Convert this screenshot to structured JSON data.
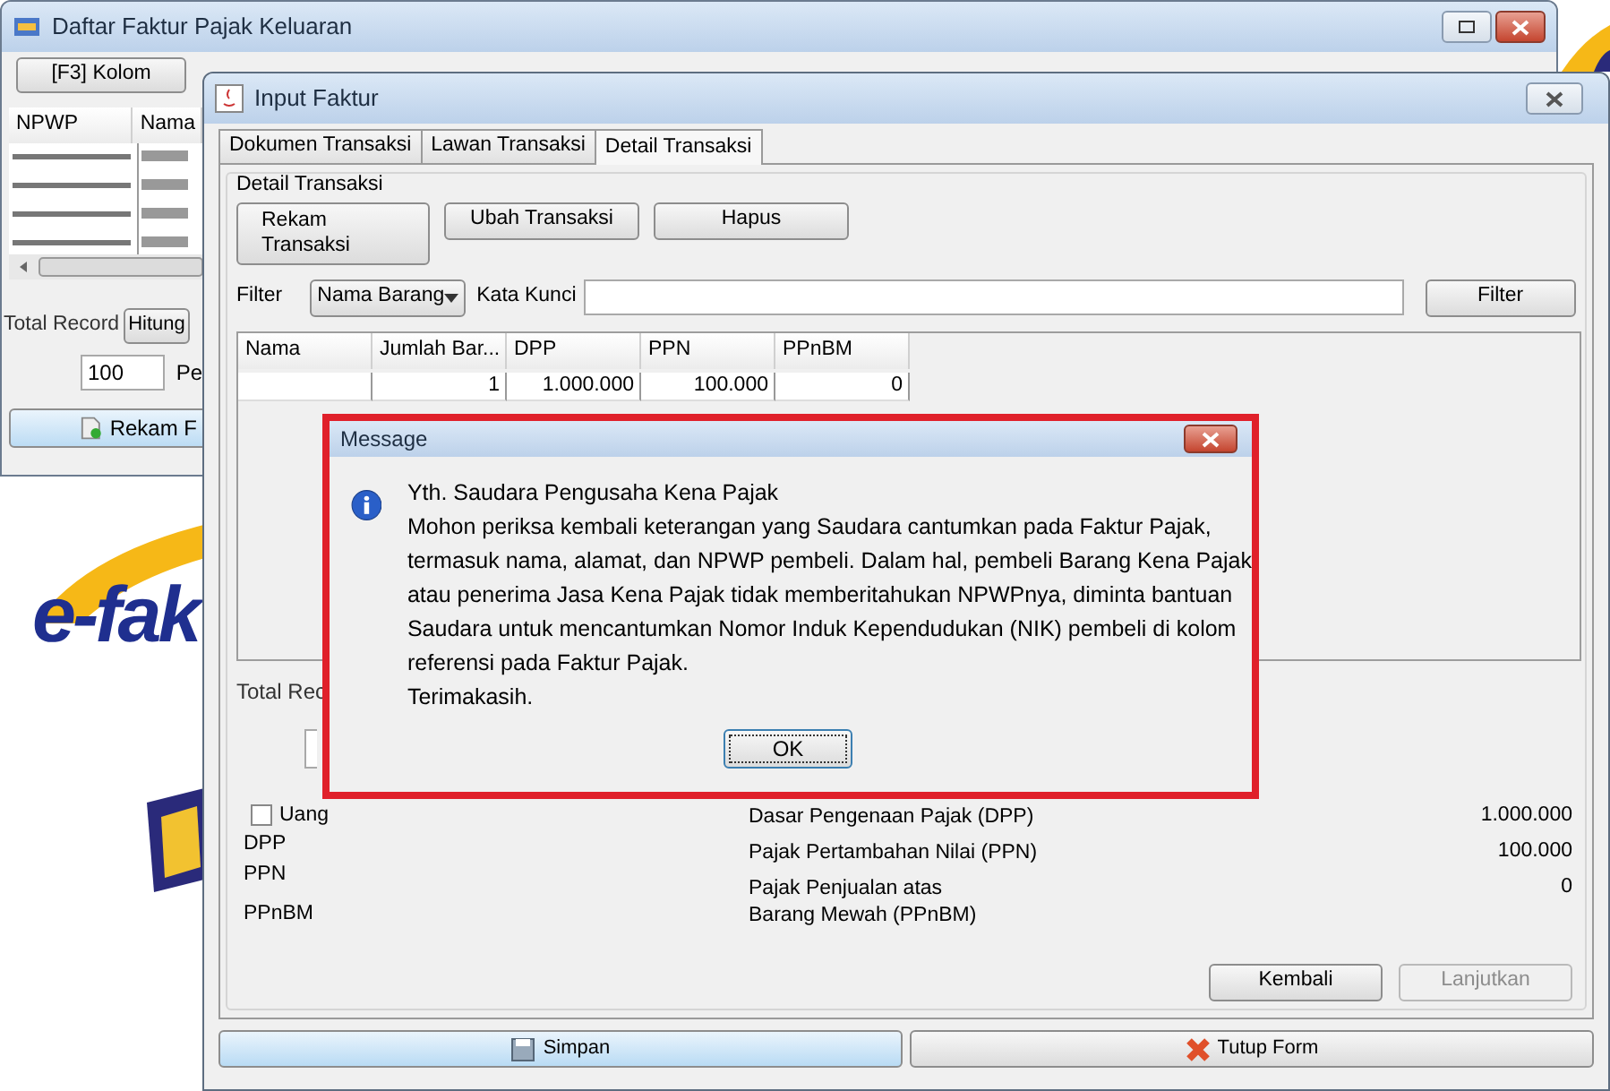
{
  "list_window": {
    "title": "Daftar Faktur Pajak Keluaran",
    "toolbar_button": "[F3] Kolom",
    "columns": [
      "NPWP",
      "Nama"
    ],
    "total_label": "Total Record",
    "count_button": "Hitung",
    "page_size": "100",
    "page_label": "Pe",
    "add_button": "Rekam F"
  },
  "desktop": {
    "logo_text": "e-fak"
  },
  "input_window": {
    "title": "Input Faktur",
    "tabs": [
      {
        "label": "Dokumen Transaksi",
        "selected": false
      },
      {
        "label": "Lawan Transaksi",
        "selected": false
      },
      {
        "label": "Detail Transaksi",
        "selected": true
      }
    ],
    "group_title": "Detail Transaksi",
    "actions": [
      "Rekam Transaksi",
      "Ubah Transaksi",
      "Hapus"
    ],
    "filter_label": "Filter",
    "filter_choice": "Nama Barang",
    "keyword_label": "Kata Kunci",
    "filter_button": "Filter",
    "table": {
      "columns": [
        "Nama",
        "Jumlah Bar...",
        "DPP",
        "PPN",
        "PPnBM"
      ],
      "rows": [
        [
          "",
          "1",
          "1.000.000",
          "100.000",
          "0"
        ]
      ]
    },
    "total_label": "Total Rec",
    "checkboxes": [
      {
        "label": "Uang",
        "checked": false
      }
    ],
    "left_labels": [
      "DPP",
      "PPN",
      "PPnBM"
    ],
    "summary": [
      {
        "label": "Dasar Pengenaan Pajak (DPP)",
        "value": "1.000.000"
      },
      {
        "label": "Pajak Pertambahan Nilai (PPN)",
        "value": "100.000"
      },
      {
        "label": "Pajak Penjualan atas\nBarang Mewah (PPnBM)",
        "value": "0"
      }
    ],
    "nav_buttons": [
      {
        "label": "Kembali",
        "disabled": false
      },
      {
        "label": "Lanjutkan",
        "disabled": true
      }
    ],
    "bottom_buttons": [
      {
        "label": "Simpan",
        "kind": "save"
      },
      {
        "label": "Tutup Form",
        "kind": "close"
      }
    ]
  },
  "dialog": {
    "title": "Message",
    "lines": [
      "Yth. Saudara Pengusaha Kena Pajak",
      "Mohon periksa kembali keterangan yang Saudara cantumkan pada Faktur Pajak,",
      "termasuk nama, alamat, dan NPWP pembeli. Dalam hal, pembeli Barang Kena Pajak",
      "atau penerima Jasa Kena Pajak tidak memberitahukan NPWPnya, diminta bantuan",
      "Saudara untuk mencantumkan Nomor Induk Kependudukan (NIK) pembeli di kolom",
      "referensi pada Faktur Pajak.",
      "Terimakasih."
    ],
    "ok_button": "OK"
  }
}
